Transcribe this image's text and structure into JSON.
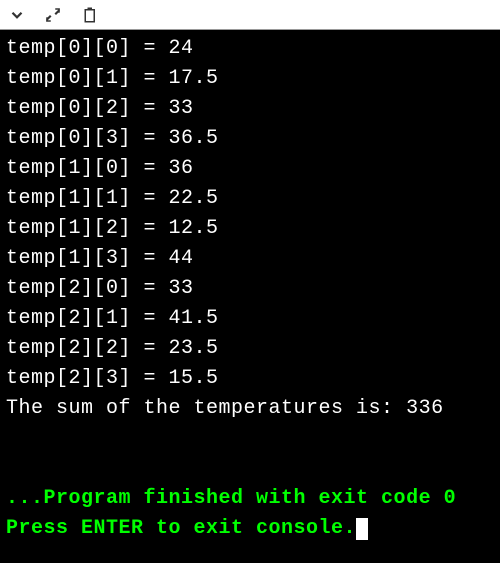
{
  "toolbar": {
    "icons": {
      "chevron": "chevron-down-icon",
      "expand": "expand-icon",
      "clipboard": "clipboard-icon"
    }
  },
  "console": {
    "lines": [
      "temp[0][0] = 24",
      "temp[0][1] = 17.5",
      "temp[0][2] = 33",
      "temp[0][3] = 36.5",
      "temp[1][0] = 36",
      "temp[1][1] = 22.5",
      "temp[1][2] = 12.5",
      "temp[1][3] = 44",
      "temp[2][0] = 33",
      "temp[2][1] = 41.5",
      "temp[2][2] = 23.5",
      "temp[2][3] = 15.5"
    ],
    "sum_line": "The sum of the temperatures is: 336",
    "exit_line": "...Program finished with exit code 0",
    "prompt_line": "Press ENTER to exit console."
  }
}
